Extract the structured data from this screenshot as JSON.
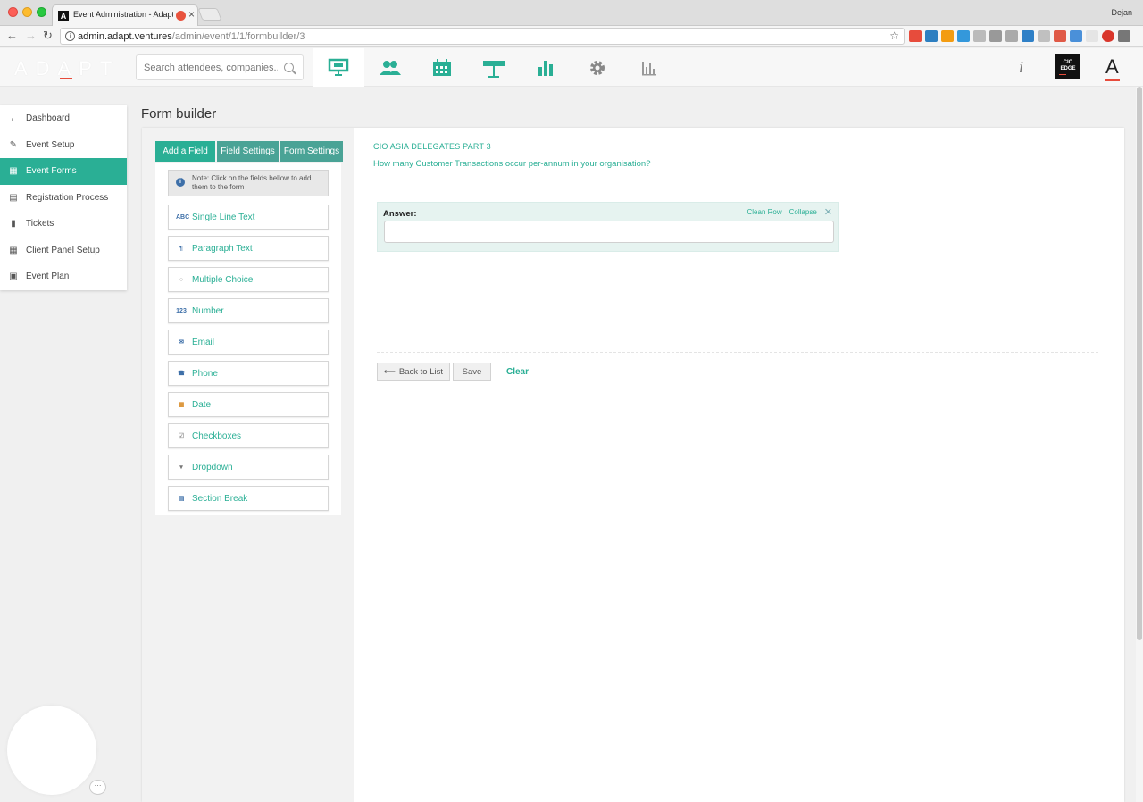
{
  "browser": {
    "tab_title": "Event Administration - Adapt",
    "url_host": "admin.adapt.ventures",
    "url_path": "/admin/event/1/1/formbuilder/3",
    "profile": "Dejan"
  },
  "header": {
    "logo_text": "ADAPT",
    "search_placeholder": "Search attendees, companies...",
    "info_glyph": "i",
    "cio_logo": "CIO EDGE",
    "avatar_letter": "A",
    "nav_icons": [
      "presentation-icon",
      "attendees-icon",
      "calendar-icon",
      "signpost-icon",
      "bar-chart-icon",
      "gear-icon",
      "reports-icon"
    ]
  },
  "sidebar": {
    "items": [
      {
        "label": "Dashboard",
        "icon": "dashboard-icon",
        "active": false
      },
      {
        "label": "Event Setup",
        "icon": "pencil-icon",
        "active": false
      },
      {
        "label": "Event Forms",
        "icon": "grid-icon",
        "active": true
      },
      {
        "label": "Registration Process",
        "icon": "table-icon",
        "active": false
      },
      {
        "label": "Tickets",
        "icon": "bookmark-icon",
        "active": false
      },
      {
        "label": "Client Panel Setup",
        "icon": "panel-icon",
        "active": false
      },
      {
        "label": "Event Plan",
        "icon": "clipboard-icon",
        "active": false
      }
    ]
  },
  "page": {
    "title": "Form builder"
  },
  "builder": {
    "tabs": [
      "Add a Field",
      "Field Settings",
      "Form Settings"
    ],
    "note": "Note: Click on the fields bellow to add them to the form",
    "fields": [
      {
        "label": "Single Line Text",
        "icon": "ABC"
      },
      {
        "label": "Paragraph Text",
        "icon": "¶"
      },
      {
        "label": "Multiple Choice",
        "icon": "○"
      },
      {
        "label": "Number",
        "icon": "123"
      },
      {
        "label": "Email",
        "icon": "✉"
      },
      {
        "label": "Phone",
        "icon": "☎"
      },
      {
        "label": "Date",
        "icon": "▦"
      },
      {
        "label": "Checkboxes",
        "icon": "☑"
      },
      {
        "label": "Dropdown",
        "icon": "▾"
      },
      {
        "label": "Section Break",
        "icon": "▤"
      }
    ]
  },
  "form": {
    "title": "CIO ASIA DELEGATES PART 3",
    "question": "How many Customer Transactions occur per-annum in your organisation?",
    "answer_label": "Answer:",
    "answer_value": "",
    "row_links": [
      "Clean Row",
      "Collapse"
    ],
    "actions": {
      "back": "Back to List",
      "save": "Save",
      "clear": "Clear"
    }
  },
  "colors": {
    "accent": "#2aaf95",
    "tab_inactive": "#4aa396",
    "answer_bg": "#e6f3f0"
  }
}
